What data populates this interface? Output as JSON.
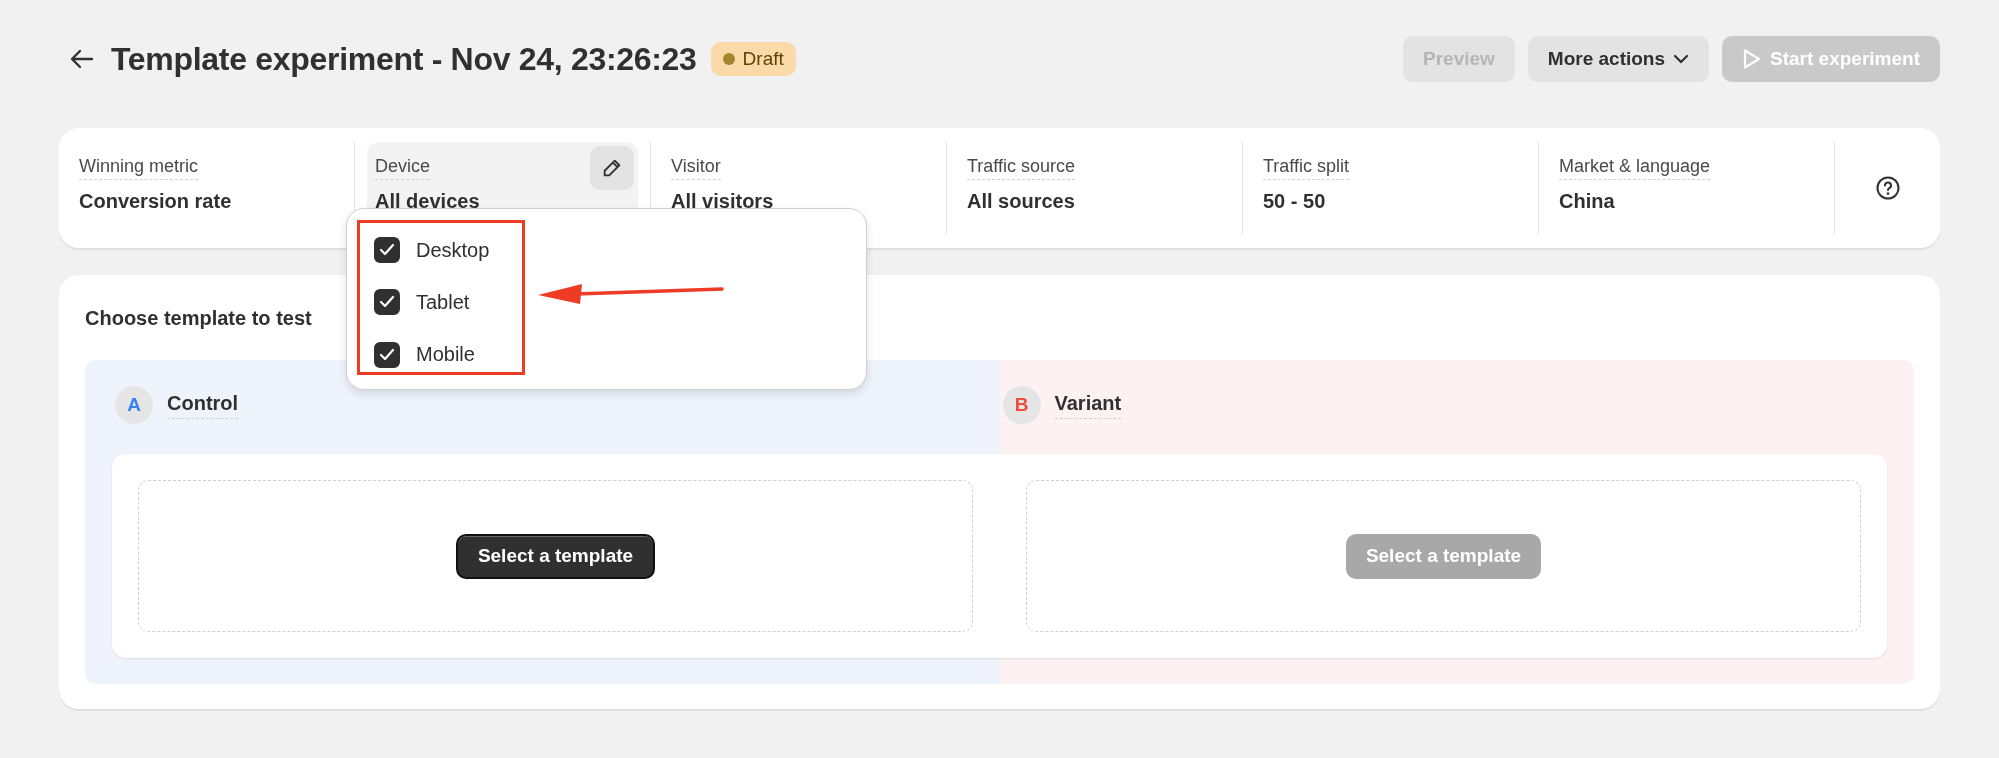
{
  "header": {
    "title": "Template experiment - Nov 24, 23:26:23",
    "status": {
      "label": "Draft"
    },
    "actions": [
      {
        "label": "Preview",
        "kind": "secondary",
        "disabled": true
      },
      {
        "label": "More actions",
        "kind": "menu",
        "disabled": false
      },
      {
        "label": "Start experiment",
        "kind": "primary",
        "disabled": true
      }
    ]
  },
  "settings": [
    {
      "label": "Winning metric",
      "value": "Conversion rate",
      "selected": false
    },
    {
      "label": "Device",
      "value": "All devices",
      "selected": true
    },
    {
      "label": "Visitor",
      "value": "All visitors",
      "selected": false
    },
    {
      "label": "Traffic source",
      "value": "All sources",
      "selected": false
    },
    {
      "label": "Traffic split",
      "value": "50 - 50",
      "selected": false
    },
    {
      "label": "Market & language",
      "value": "China",
      "selected": false
    }
  ],
  "device_menu": {
    "options": [
      {
        "label": "Desktop",
        "checked": true
      },
      {
        "label": "Tablet",
        "checked": true
      },
      {
        "label": "Mobile",
        "checked": true
      }
    ]
  },
  "template_section": {
    "title": "Choose template to test",
    "variants": [
      {
        "letter": "A",
        "name": "Control",
        "color": "#3b7ff5",
        "button": {
          "label": "Select a template",
          "disabled": false
        }
      },
      {
        "letter": "B",
        "name": "Variant",
        "color": "#ef4a3c",
        "button": {
          "label": "Select a template",
          "disabled": true
        }
      }
    ]
  }
}
